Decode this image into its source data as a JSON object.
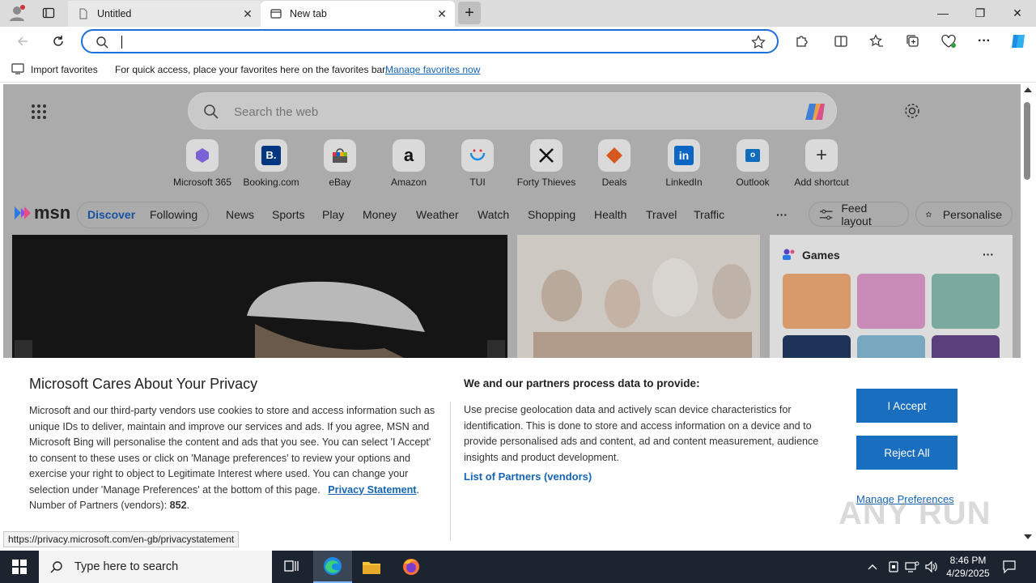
{
  "browser": {
    "tabs": [
      {
        "title": "Untitled",
        "active": false
      },
      {
        "title": "New tab",
        "active": true
      }
    ],
    "address": {
      "value": "",
      "placeholder": ""
    },
    "favorites_bar": {
      "import_label": "Import favorites",
      "hint": "For quick access, place your favorites here on the favorites bar.",
      "manage_link": "Manage favorites now"
    }
  },
  "new_tab": {
    "search_placeholder": "Search the web",
    "shortcuts": [
      {
        "label": "Microsoft 365",
        "icon": "microsoft-365-icon"
      },
      {
        "label": "Booking.com",
        "icon": "booking-icon"
      },
      {
        "label": "eBay",
        "icon": "ebay-icon"
      },
      {
        "label": "Amazon",
        "icon": "amazon-icon"
      },
      {
        "label": "TUI",
        "icon": "tui-icon"
      },
      {
        "label": "Forty Thieves",
        "icon": "forty-thieves-icon"
      },
      {
        "label": "Deals",
        "icon": "deals-icon"
      },
      {
        "label": "LinkedIn",
        "icon": "linkedin-icon"
      },
      {
        "label": "Outlook",
        "icon": "outlook-icon"
      },
      {
        "label": "Add shortcut",
        "icon": "plus-icon"
      }
    ],
    "msn": {
      "logo": "msn",
      "tabs": [
        "Discover",
        "Following"
      ],
      "nav": [
        "News",
        "Sports",
        "Play",
        "Money",
        "Weather",
        "Watch",
        "Shopping",
        "Health",
        "Travel",
        "Traffic"
      ],
      "more": "···",
      "feed_layout": "Feed layout",
      "personalise": "Personalise",
      "games_title": "Games",
      "games_more": "···"
    }
  },
  "privacy": {
    "title": "Microsoft Cares About Your Privacy",
    "body": "Microsoft and our third-party vendors use cookies to store and access information such as unique IDs to deliver, maintain and improve our services and ads. If you agree, MSN and Microsoft Bing will personalise the content and ads that you see. You can select 'I Accept' to consent to these uses or click on 'Manage preferences' to review your options and exercise your right to object to Legitimate Interest where used.  You can change your selection under 'Manage Preferences' at the bottom of this page.",
    "privacy_link": "Privacy Statement",
    "partners_count_label": "Number of Partners (vendors):",
    "partners_count": "852",
    "purposes_title": "We and our partners process data to provide:",
    "purposes_body": "Use precise geolocation data and actively scan device characteristics for identification. This is done to store and access information on a device and to provide personalised ads and content, ad and content measurement, audience insights and product development.",
    "partners_list_link": "List of Partners (vendors)",
    "accept": "I Accept",
    "reject": "Reject All",
    "manage": "Manage Preferences"
  },
  "status_url": "https://privacy.microsoft.com/en-gb/privacystatement",
  "watermark": "ANY RUN",
  "taskbar": {
    "search_placeholder": "Type here to search",
    "time": "8:46 PM",
    "date": "4/29/2025"
  },
  "colors": {
    "accent": "#1a6ec0",
    "link": "#1664b4",
    "taskbar": "#1c2430"
  }
}
